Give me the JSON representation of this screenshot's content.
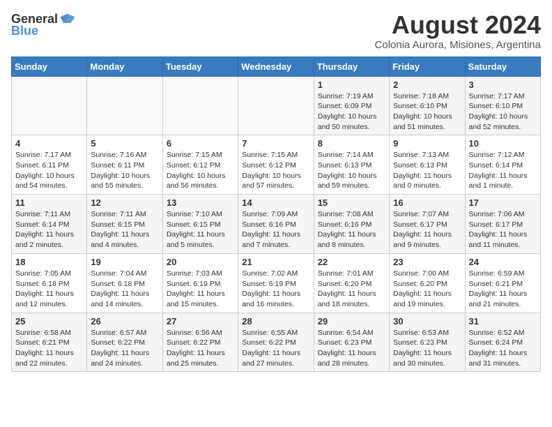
{
  "logo": {
    "general": "General",
    "blue": "Blue"
  },
  "title": "August 2024",
  "subtitle": "Colonia Aurora, Misiones, Argentina",
  "days_of_week": [
    "Sunday",
    "Monday",
    "Tuesday",
    "Wednesday",
    "Thursday",
    "Friday",
    "Saturday"
  ],
  "weeks": [
    [
      {
        "day": "",
        "info": ""
      },
      {
        "day": "",
        "info": ""
      },
      {
        "day": "",
        "info": ""
      },
      {
        "day": "",
        "info": ""
      },
      {
        "day": "1",
        "info": "Sunrise: 7:19 AM\nSunset: 6:09 PM\nDaylight: 10 hours and 50 minutes."
      },
      {
        "day": "2",
        "info": "Sunrise: 7:18 AM\nSunset: 6:10 PM\nDaylight: 10 hours and 51 minutes."
      },
      {
        "day": "3",
        "info": "Sunrise: 7:17 AM\nSunset: 6:10 PM\nDaylight: 10 hours and 52 minutes."
      }
    ],
    [
      {
        "day": "4",
        "info": "Sunrise: 7:17 AM\nSunset: 6:11 PM\nDaylight: 10 hours and 54 minutes."
      },
      {
        "day": "5",
        "info": "Sunrise: 7:16 AM\nSunset: 6:11 PM\nDaylight: 10 hours and 55 minutes."
      },
      {
        "day": "6",
        "info": "Sunrise: 7:15 AM\nSunset: 6:12 PM\nDaylight: 10 hours and 56 minutes."
      },
      {
        "day": "7",
        "info": "Sunrise: 7:15 AM\nSunset: 6:12 PM\nDaylight: 10 hours and 57 minutes."
      },
      {
        "day": "8",
        "info": "Sunrise: 7:14 AM\nSunset: 6:13 PM\nDaylight: 10 hours and 59 minutes."
      },
      {
        "day": "9",
        "info": "Sunrise: 7:13 AM\nSunset: 6:13 PM\nDaylight: 11 hours and 0 minutes."
      },
      {
        "day": "10",
        "info": "Sunrise: 7:12 AM\nSunset: 6:14 PM\nDaylight: 11 hours and 1 minute."
      }
    ],
    [
      {
        "day": "11",
        "info": "Sunrise: 7:11 AM\nSunset: 6:14 PM\nDaylight: 11 hours and 2 minutes."
      },
      {
        "day": "12",
        "info": "Sunrise: 7:11 AM\nSunset: 6:15 PM\nDaylight: 11 hours and 4 minutes."
      },
      {
        "day": "13",
        "info": "Sunrise: 7:10 AM\nSunset: 6:15 PM\nDaylight: 11 hours and 5 minutes."
      },
      {
        "day": "14",
        "info": "Sunrise: 7:09 AM\nSunset: 6:16 PM\nDaylight: 11 hours and 7 minutes."
      },
      {
        "day": "15",
        "info": "Sunrise: 7:08 AM\nSunset: 6:16 PM\nDaylight: 11 hours and 8 minutes."
      },
      {
        "day": "16",
        "info": "Sunrise: 7:07 AM\nSunset: 6:17 PM\nDaylight: 11 hours and 9 minutes."
      },
      {
        "day": "17",
        "info": "Sunrise: 7:06 AM\nSunset: 6:17 PM\nDaylight: 11 hours and 11 minutes."
      }
    ],
    [
      {
        "day": "18",
        "info": "Sunrise: 7:05 AM\nSunset: 6:18 PM\nDaylight: 11 hours and 12 minutes."
      },
      {
        "day": "19",
        "info": "Sunrise: 7:04 AM\nSunset: 6:18 PM\nDaylight: 11 hours and 14 minutes."
      },
      {
        "day": "20",
        "info": "Sunrise: 7:03 AM\nSunset: 6:19 PM\nDaylight: 11 hours and 15 minutes."
      },
      {
        "day": "21",
        "info": "Sunrise: 7:02 AM\nSunset: 6:19 PM\nDaylight: 11 hours and 16 minutes."
      },
      {
        "day": "22",
        "info": "Sunrise: 7:01 AM\nSunset: 6:20 PM\nDaylight: 11 hours and 18 minutes."
      },
      {
        "day": "23",
        "info": "Sunrise: 7:00 AM\nSunset: 6:20 PM\nDaylight: 11 hours and 19 minutes."
      },
      {
        "day": "24",
        "info": "Sunrise: 6:59 AM\nSunset: 6:21 PM\nDaylight: 11 hours and 21 minutes."
      }
    ],
    [
      {
        "day": "25",
        "info": "Sunrise: 6:58 AM\nSunset: 6:21 PM\nDaylight: 11 hours and 22 minutes."
      },
      {
        "day": "26",
        "info": "Sunrise: 6:57 AM\nSunset: 6:22 PM\nDaylight: 11 hours and 24 minutes."
      },
      {
        "day": "27",
        "info": "Sunrise: 6:56 AM\nSunset: 6:22 PM\nDaylight: 11 hours and 25 minutes."
      },
      {
        "day": "28",
        "info": "Sunrise: 6:55 AM\nSunset: 6:22 PM\nDaylight: 11 hours and 27 minutes."
      },
      {
        "day": "29",
        "info": "Sunrise: 6:54 AM\nSunset: 6:23 PM\nDaylight: 11 hours and 28 minutes."
      },
      {
        "day": "30",
        "info": "Sunrise: 6:53 AM\nSunset: 6:23 PM\nDaylight: 11 hours and 30 minutes."
      },
      {
        "day": "31",
        "info": "Sunrise: 6:52 AM\nSunset: 6:24 PM\nDaylight: 11 hours and 31 minutes."
      }
    ]
  ]
}
